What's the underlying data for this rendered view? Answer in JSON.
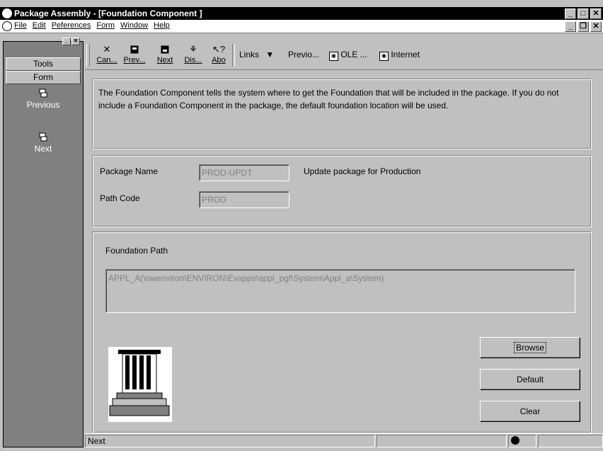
{
  "window": {
    "title": "Package Assembly - [Foundation Component ]"
  },
  "menu": {
    "items": [
      "File",
      "Edit",
      "Peferences",
      "Form",
      "Window",
      "Help"
    ]
  },
  "sidebar": {
    "tabs": [
      "Tools",
      "Form"
    ],
    "items": [
      {
        "label": "Previous",
        "icon": "previous-form-icon"
      },
      {
        "label": "Next",
        "icon": "next-form-icon"
      }
    ]
  },
  "toolbar": {
    "buttons": [
      {
        "label": "Can...",
        "icon": "cancel-x-icon"
      },
      {
        "label": "Prev...",
        "icon": "previous-record-icon"
      },
      {
        "label": "Next",
        "icon": "next-record-icon"
      },
      {
        "label": "Dis...",
        "icon": "display-icon"
      },
      {
        "label": "Abo",
        "icon": "about-help-icon"
      }
    ],
    "links_label": "Links",
    "links": [
      "Previo...",
      "OLE ...",
      "Internet"
    ]
  },
  "description": "The Foundation Component tells  the system where to get the Foundation that will be included in the package.  If you do not include a Foundation Component in the package, the default foundation location will be used.",
  "package": {
    "name_label": "Package Name",
    "name_value": "PROD-UPDT",
    "name_description": "Update package for Production",
    "path_label": "Path Code",
    "path_value": "PROD"
  },
  "foundation": {
    "label": "Foundation Path",
    "path_value": "APPL_A(\\owenviron\\ENVIRON\\Evapps\\appl_pgf\\System\\Appl_a\\System)",
    "buttons": {
      "browse": "Browse",
      "default": "Default",
      "clear": "Clear"
    }
  },
  "status": {
    "text": "Next"
  }
}
